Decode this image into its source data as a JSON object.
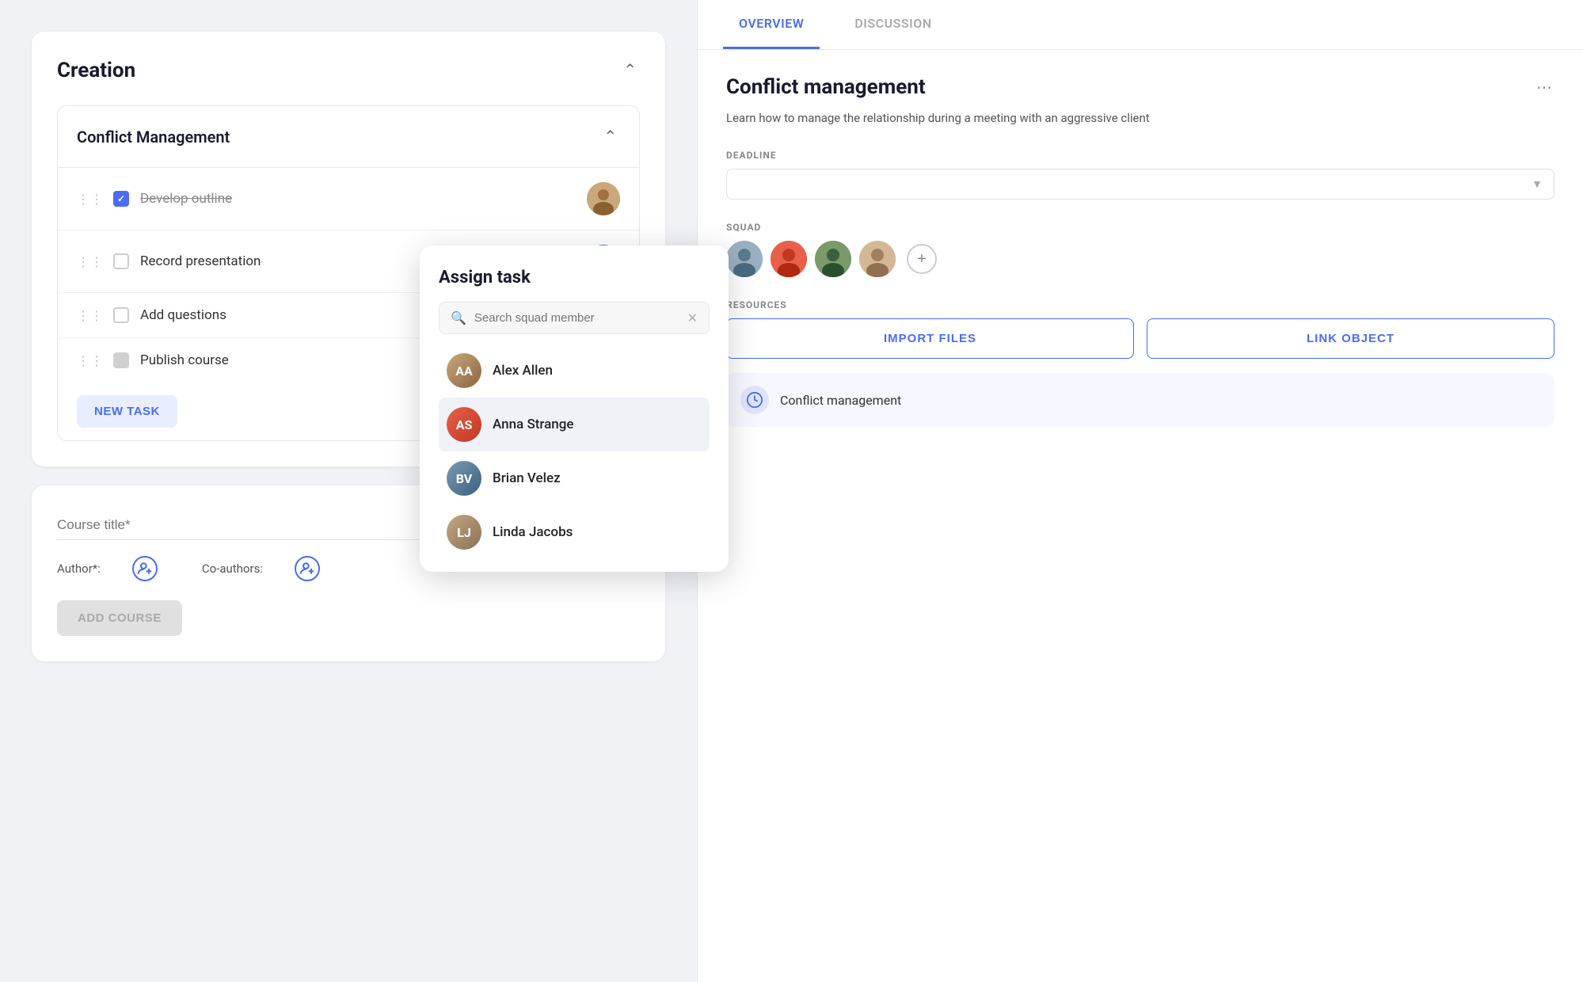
{
  "left": {
    "creation_title": "Creation",
    "section_title": "Conflict Management",
    "tasks": [
      {
        "id": 1,
        "label": "Develop outline",
        "checked": true,
        "disabled": false,
        "strikethrough": true,
        "has_avatar": true
      },
      {
        "id": 2,
        "label": "Record presentation",
        "checked": false,
        "disabled": false,
        "strikethrough": false,
        "has_avatar": false
      },
      {
        "id": 3,
        "label": "Add questions",
        "checked": false,
        "disabled": false,
        "strikethrough": false,
        "has_avatar": false
      },
      {
        "id": 4,
        "label": "Publish course",
        "checked": false,
        "disabled": true,
        "strikethrough": false,
        "has_avatar": false
      }
    ],
    "new_task_label": "NEW TASK",
    "course_title_placeholder": "Course title*",
    "author_label": "Author*:",
    "coauthors_label": "Co-authors:",
    "add_course_label": "ADD COURSE"
  },
  "assign_popup": {
    "title": "Assign task",
    "search_placeholder": "Search squad member",
    "members": [
      {
        "id": 1,
        "name": "Alex Allen",
        "av_class": "av-alex",
        "initials": "AA"
      },
      {
        "id": 2,
        "name": "Anna Strange",
        "av_class": "av-anna",
        "initials": "AS",
        "selected": true
      },
      {
        "id": 3,
        "name": "Brian Velez",
        "av_class": "av-brian",
        "initials": "BV"
      },
      {
        "id": 4,
        "name": "Linda Jacobs",
        "av_class": "av-linda",
        "initials": "LJ"
      }
    ]
  },
  "right": {
    "tabs": [
      {
        "id": "overview",
        "label": "OVERVIEW",
        "active": true
      },
      {
        "id": "discussion",
        "label": "DISCUSSION",
        "active": false
      }
    ],
    "section_title": "Conflict management",
    "description": "Learn how to manage the relationship during a meeting with an aggressive client",
    "deadline_label": "DEADLINE",
    "deadline_value": "",
    "squad_label": "SQUAD",
    "resources_label": "RESOURCES",
    "import_files_label": "IMPORT FILES",
    "link_object_label": "LINK OBJECT",
    "resource_item": "Conflict management"
  }
}
